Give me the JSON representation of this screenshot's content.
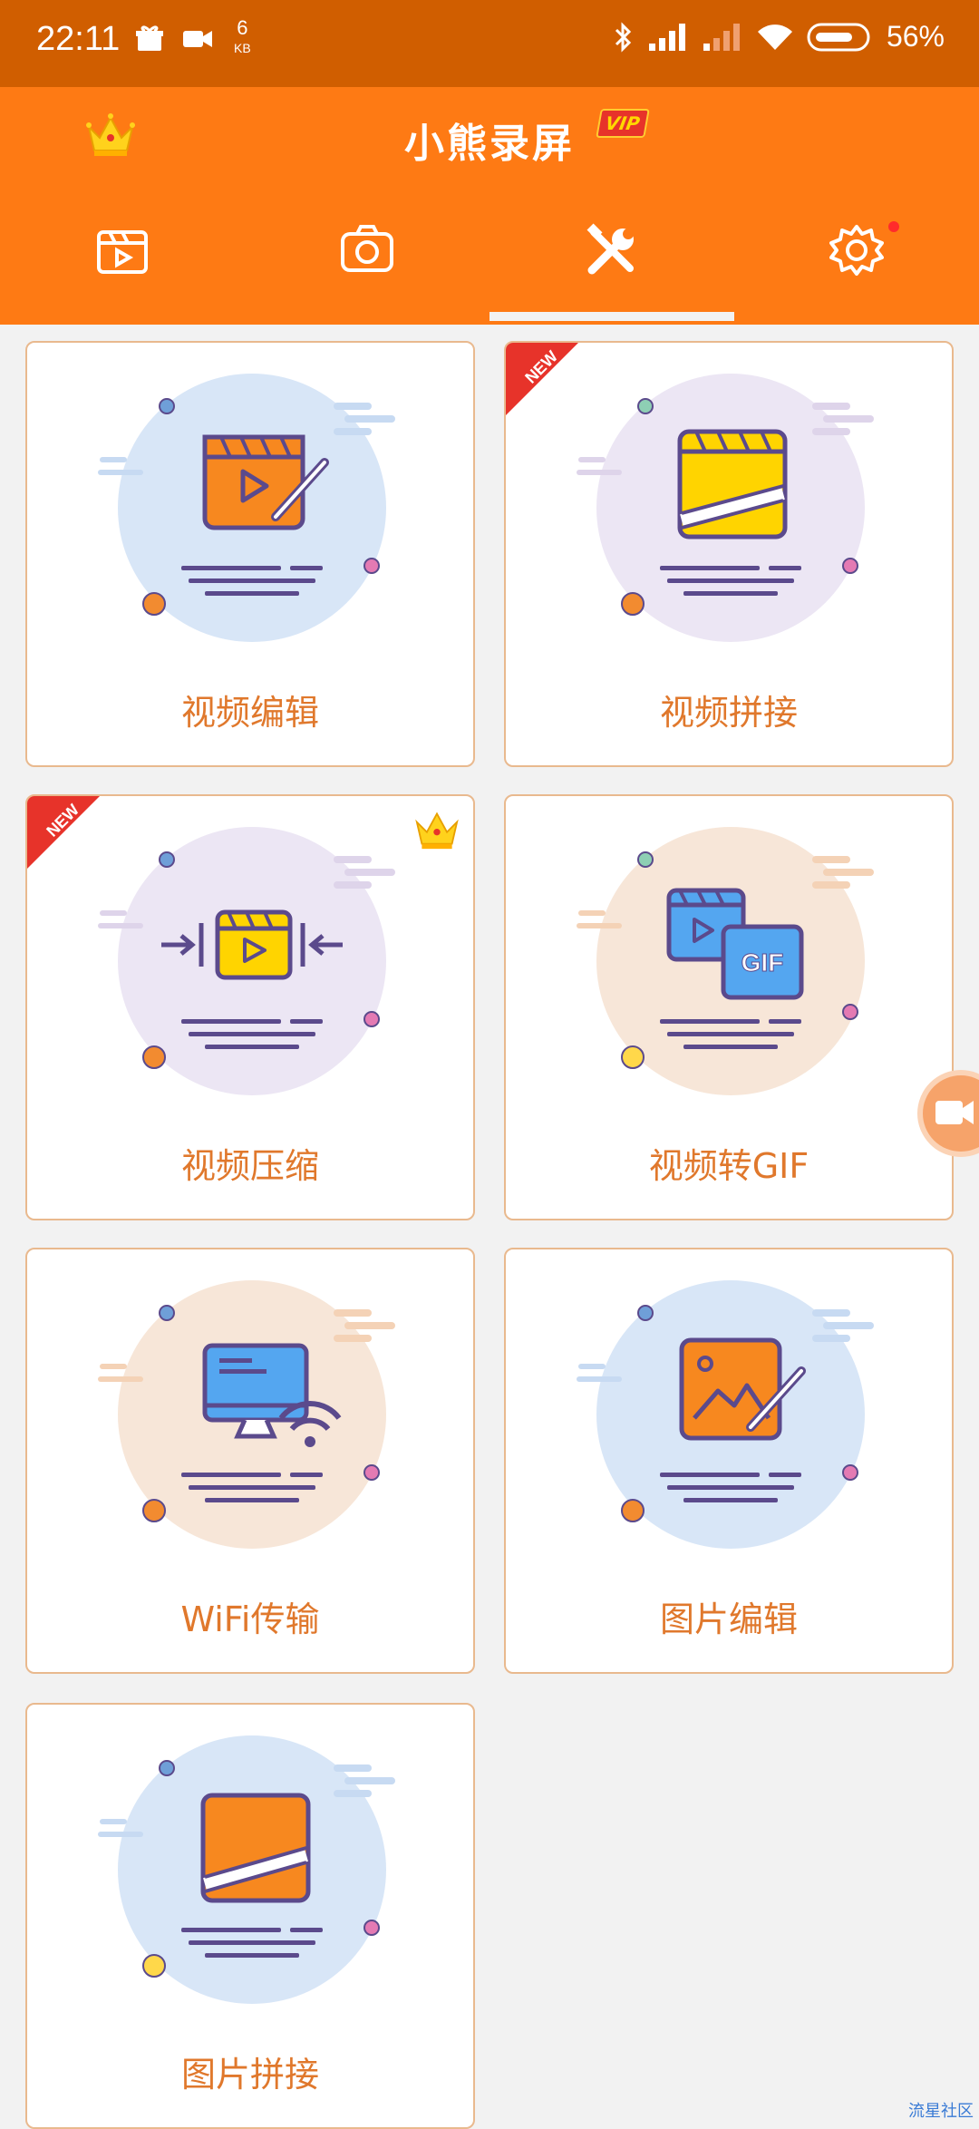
{
  "status_bar": {
    "time": "22:11",
    "net_speed": "6",
    "net_unit": "KB",
    "battery": "56%",
    "icons": [
      "gift-icon",
      "video-icon",
      "bluetooth-icon",
      "signal-icon",
      "signal-icon",
      "wifi-icon",
      "battery-icon"
    ]
  },
  "app": {
    "title": "小熊录屏",
    "vip_label": "VIP",
    "accent": "#fe7a14",
    "status_color": "#d05e00"
  },
  "tabs": [
    {
      "icon": "video-clapper-icon",
      "active": false
    },
    {
      "icon": "camera-icon",
      "active": false
    },
    {
      "icon": "tools-icon",
      "active": true
    },
    {
      "icon": "settings-icon",
      "active": false,
      "badge_dot": true
    }
  ],
  "tools": [
    {
      "label": "视频编辑",
      "new": false,
      "vip": false,
      "icon": "video-edit-icon"
    },
    {
      "label": "视频拼接",
      "new": true,
      "vip": false,
      "icon": "video-merge-icon"
    },
    {
      "label": "视频压缩",
      "new": true,
      "vip": true,
      "icon": "video-compress-icon"
    },
    {
      "label": "视频转GIF",
      "new": false,
      "vip": false,
      "icon": "video-to-gif-icon"
    },
    {
      "label": "WiFi传输",
      "new": false,
      "vip": false,
      "icon": "wifi-transfer-icon"
    },
    {
      "label": "图片编辑",
      "new": false,
      "vip": false,
      "icon": "image-edit-icon"
    },
    {
      "label": "图片拼接",
      "new": false,
      "vip": false,
      "icon": "image-merge-icon"
    }
  ],
  "new_label": "NEW",
  "gif_label": "GIF",
  "watermark": "流星社区"
}
